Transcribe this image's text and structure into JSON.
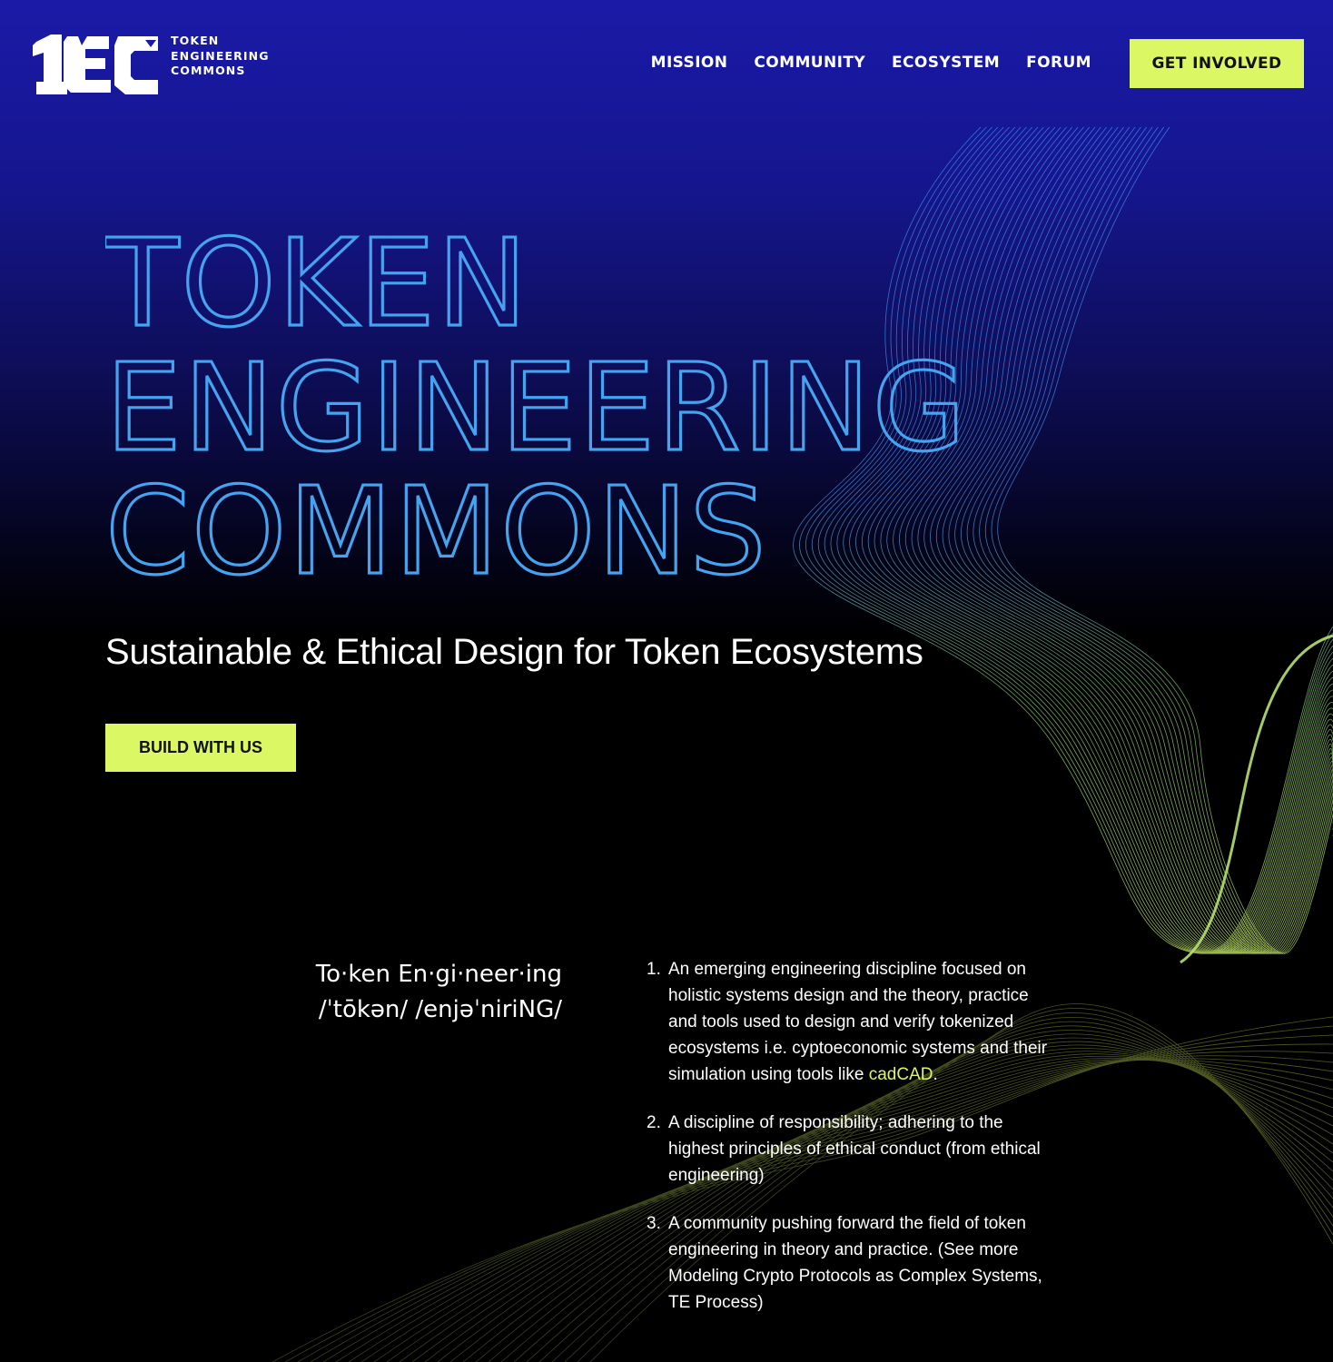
{
  "logo": {
    "text_lines": [
      "TOKEN",
      "ENGINEERING",
      "COMMONS"
    ],
    "mark_text": "TEC"
  },
  "nav": {
    "items": [
      {
        "label": "MISSION"
      },
      {
        "label": "COMMUNITY"
      },
      {
        "label": "ECOSYSTEM"
      },
      {
        "label": "FORUM"
      }
    ],
    "cta_label": "GET INVOLVED"
  },
  "hero": {
    "title_lines": [
      "TOKEN",
      "ENGINEERING",
      "COMMONS"
    ],
    "subtitle": "Sustainable & Ethical Design for Token Ecosystems",
    "button_label": "BUILD WITH US"
  },
  "definition": {
    "term": "To·ken En·gi·neer·ing",
    "pronunciation": "/ˈtōkən/ /enjəˈniriNG/",
    "items": [
      {
        "number": "1.",
        "text": "An emerging engineering discipline focused on holistic systems design and the theory, practice and tools used to design and verify tokenized ecosystems i.e. cyptoeconomic systems and their simulation using tools like ",
        "link": "cadCAD",
        "after": "."
      },
      {
        "number": "2.",
        "text": "A discipline of responsibility; adhering to the highest principles of ethical conduct (from ethical engineering)"
      },
      {
        "number": "3.",
        "text": "A community pushing forward the field of token engineering in theory and practice. (See more Modeling Crypto Protocols as Complex Systems, TE Process)"
      }
    ]
  },
  "colors": {
    "accent": "#dcf764",
    "outline_text": "#45a4ef",
    "header_bg": "#1a1aa8",
    "body_bg": "#000000"
  }
}
